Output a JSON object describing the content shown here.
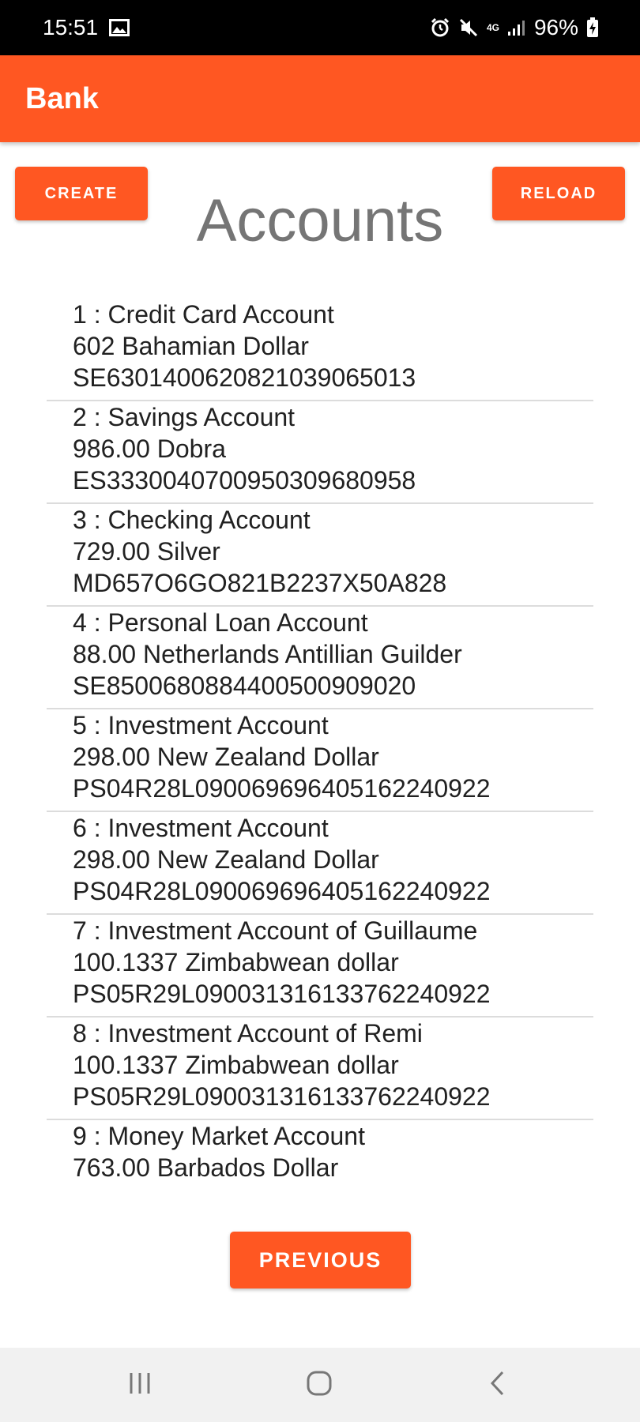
{
  "status_bar": {
    "time": "15:51",
    "battery": "96%",
    "network": "4G",
    "icons": [
      "image-icon",
      "alarm-icon",
      "mute-icon",
      "signal-icon",
      "battery-charging-icon"
    ]
  },
  "appbar": {
    "title": "Bank"
  },
  "toolbar": {
    "create_label": "CREATE",
    "reload_label": "RELOAD"
  },
  "page": {
    "heading": "Accounts"
  },
  "accounts": [
    {
      "title": "1 : Credit Card Account",
      "balance": "602 Bahamian Dollar",
      "iban": "SE6301400620821039065013"
    },
    {
      "title": "2 : Savings Account",
      "balance": "986.00 Dobra",
      "iban": "ES3330040700950309680958"
    },
    {
      "title": "3 : Checking Account",
      "balance": "729.00 Silver",
      "iban": "MD657O6GO821B2237X50A828"
    },
    {
      "title": "4 : Personal Loan Account",
      "balance": "88.00 Netherlands Antillian Guilder",
      "iban": "SE8500680884400500909020"
    },
    {
      "title": "5 : Investment Account",
      "balance": "298.00 New Zealand Dollar",
      "iban": "PS04R28L090069696405162240922"
    },
    {
      "title": "6 : Investment Account",
      "balance": "298.00 New Zealand Dollar",
      "iban": "PS04R28L090069696405162240922"
    },
    {
      "title": "7 : Investment Account of Guillaume",
      "balance": "100.1337 Zimbabwean dollar",
      "iban": "PS05R29L090031316133762240922"
    },
    {
      "title": "8 : Investment Account of Remi",
      "balance": "100.1337 Zimbabwean dollar",
      "iban": "PS05R29L090031316133762240922"
    },
    {
      "title": "9 : Money Market Account",
      "balance": "763.00 Barbados Dollar",
      "iban": ""
    }
  ],
  "pagination": {
    "previous_label": "PREVIOUS"
  },
  "navbar": {
    "icons": [
      "recents-icon",
      "home-icon",
      "back-icon"
    ]
  },
  "colors": {
    "accent": "#FF5722",
    "heading": "#757575",
    "text": "#212121",
    "navbar": "#f1f1f1"
  }
}
